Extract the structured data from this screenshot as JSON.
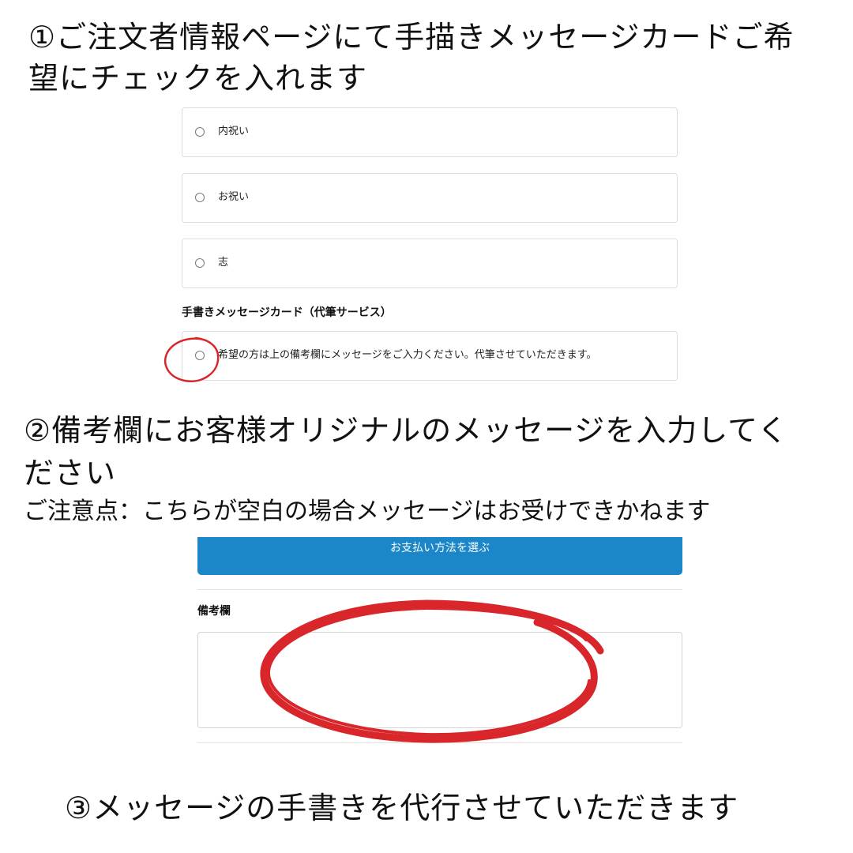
{
  "steps": {
    "step1_line1": "①ご注文者情報ページにて手描きメッセージカードご希",
    "step1_line2": "望にチェックを入れます",
    "step2_line1": "②備考欄にお客様オリジナルのメッセージを入力してく",
    "step2_line2": "ださい",
    "note": "ご注意点：こちらが空白の場合メッセージはお受けできかねます",
    "step3": "③メッセージの手書きを代行させていただきます"
  },
  "options": {
    "naishugi": "内祝い",
    "oiwai": "お祝い",
    "kokorozashi": "志"
  },
  "card_section": {
    "title": "手書きメッセージカード（代筆サービス）",
    "option_label": "希望の方は上の備考欄にメッセージをご入力ください。代筆させていただきます。"
  },
  "payment": {
    "button_label": "お支払い方法を選ぶ"
  },
  "remarks": {
    "label": "備考欄"
  },
  "colors": {
    "accent_blue": "#1b87c9",
    "annotation_red": "#d8262b"
  }
}
